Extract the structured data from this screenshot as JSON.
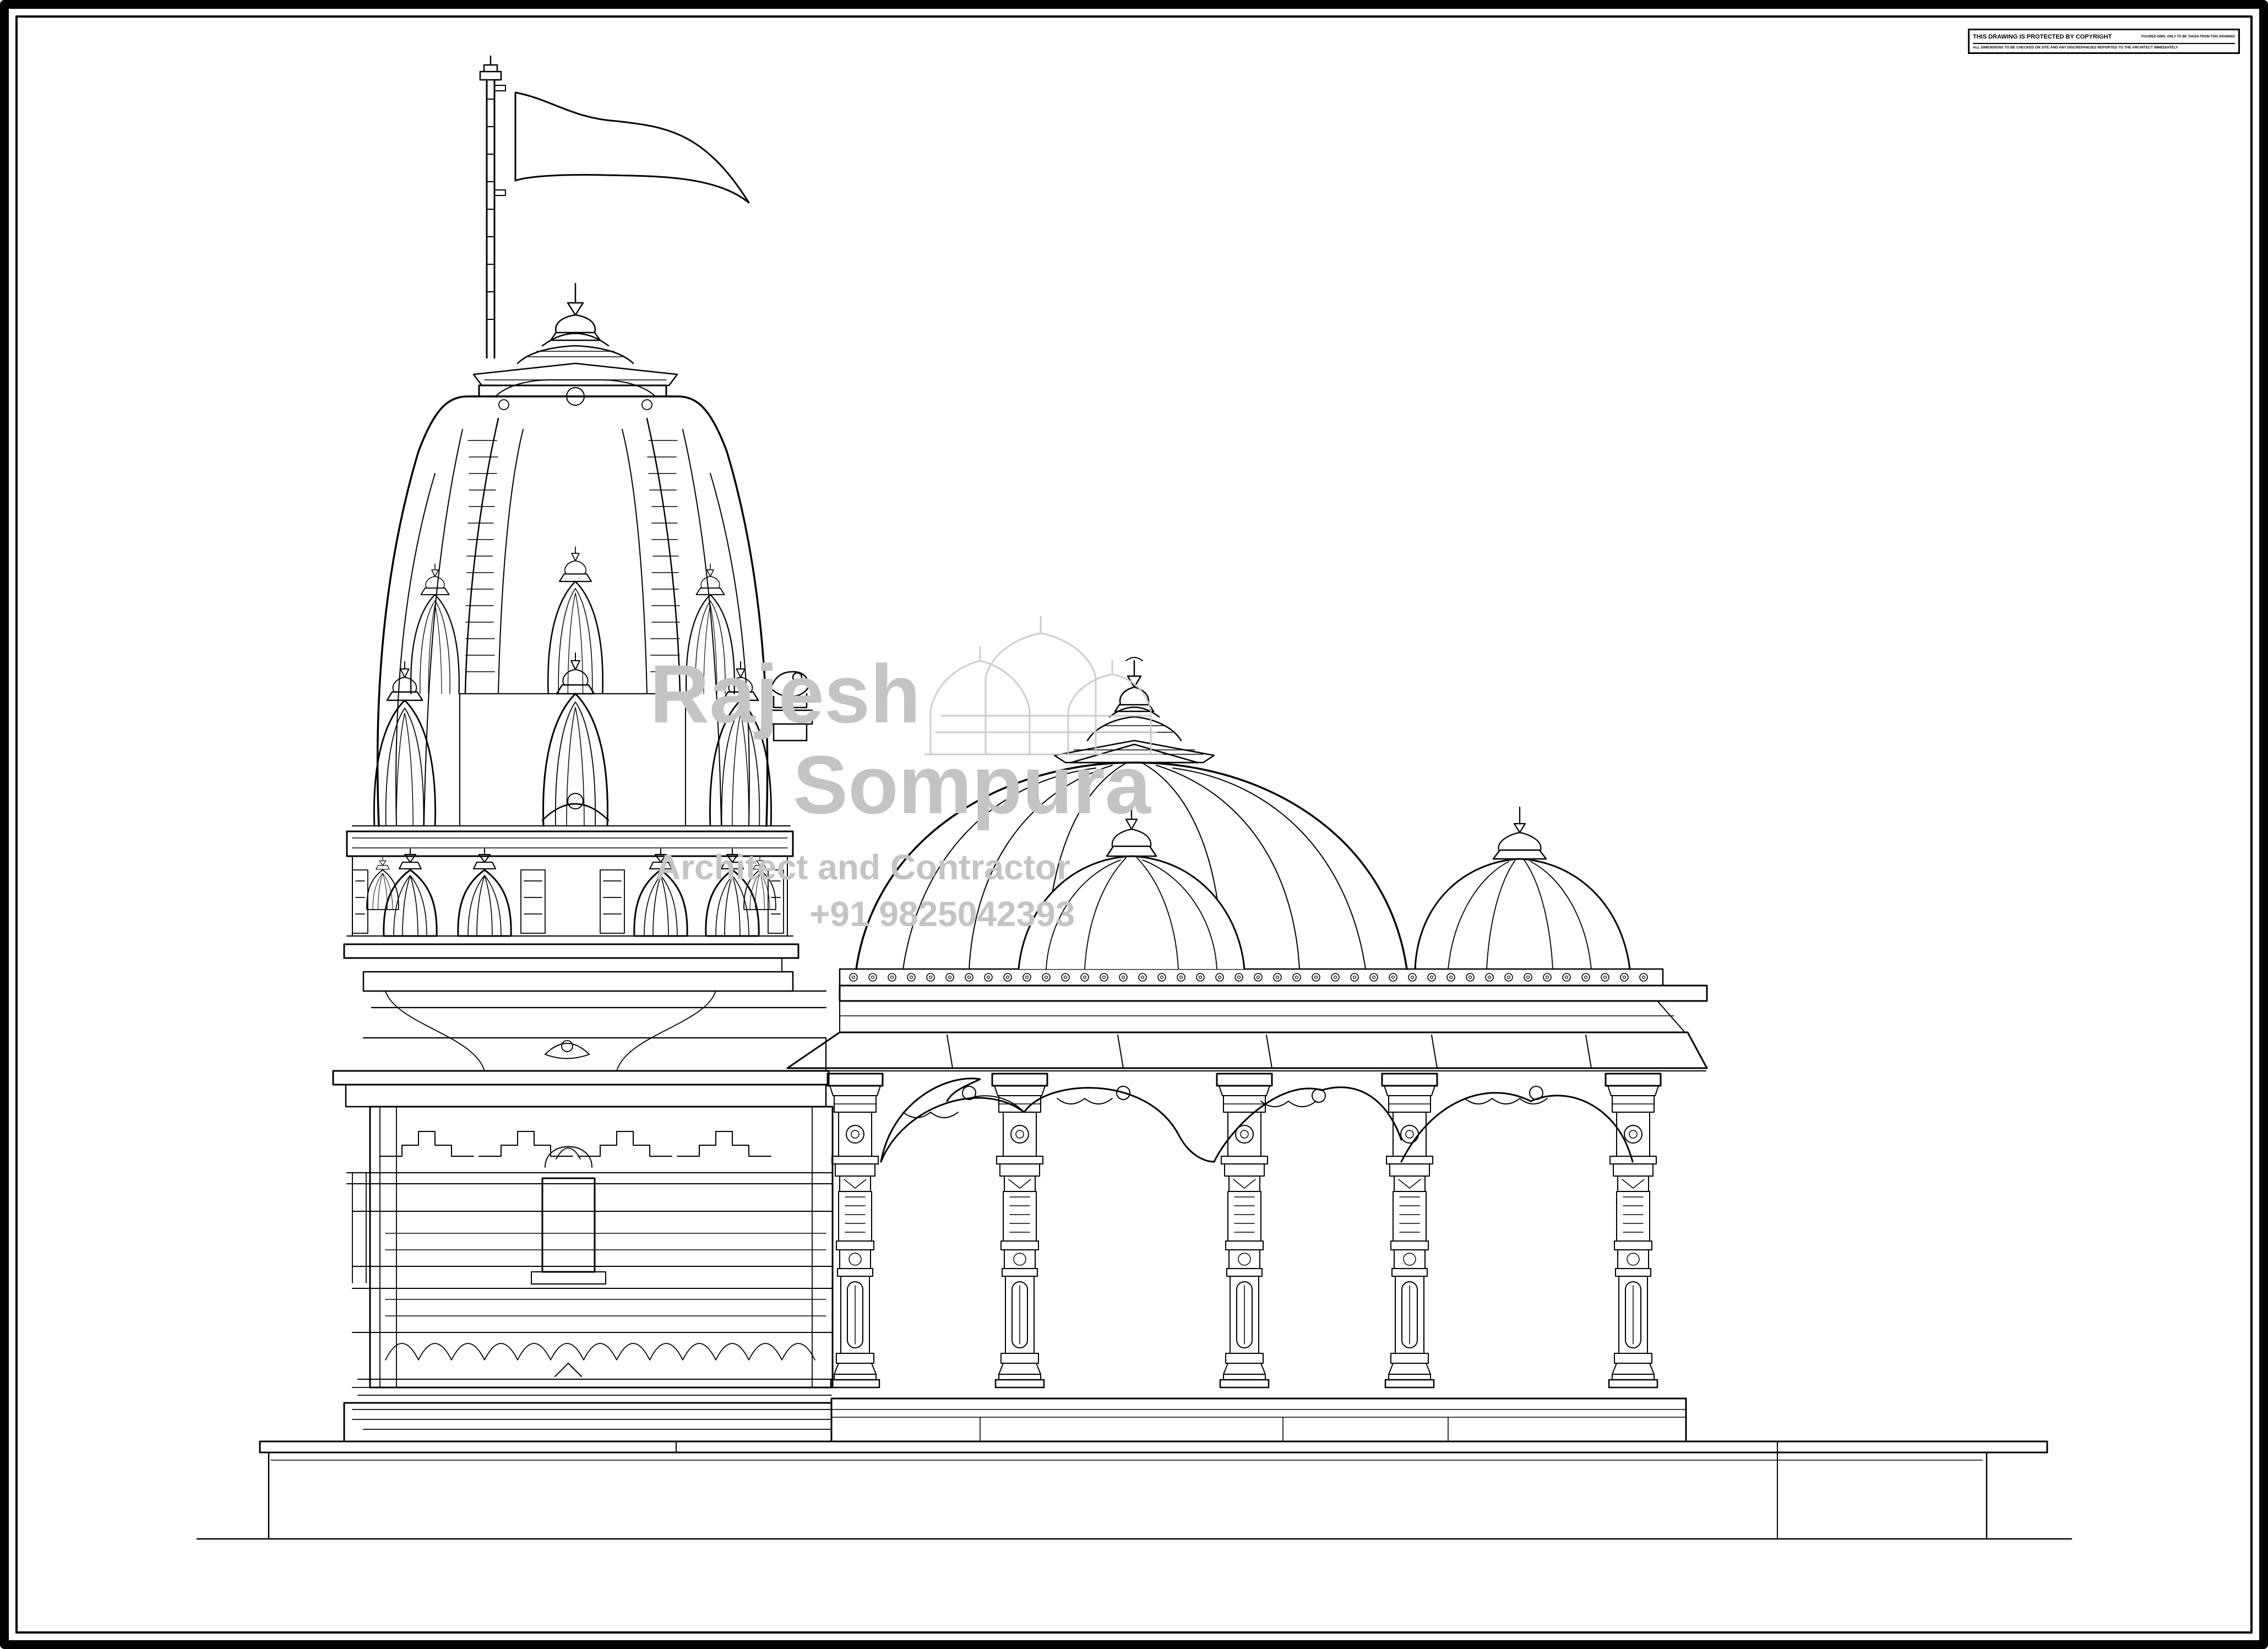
{
  "notice": {
    "line1_left": "THIS DRAWING IS PROTECTED BY COPYRIGHT",
    "line1_right": "FIGURED DIMS. ONLY TO BE TAKEN FROM THIS DRAWING",
    "line2": "ALL DIMENSIONS TO BE CHECKED ON SITE AND ANY DISCREPANCIES REPORTED TO THE ARCHITECT IMMEDIATELY"
  },
  "watermark": {
    "name_line1": "Rajesh",
    "name_line2": "Sompura",
    "subtitle": "Architect and Contractor",
    "phone": "+91 9825042393"
  },
  "colors": {
    "line": "#000000",
    "paper": "#ffffff",
    "watermark": "#c4c4c4"
  },
  "icons": [
    "flag-icon",
    "shikhara-spire",
    "dome",
    "pillar",
    "lion-statue",
    "temple-watermark-icon"
  ]
}
